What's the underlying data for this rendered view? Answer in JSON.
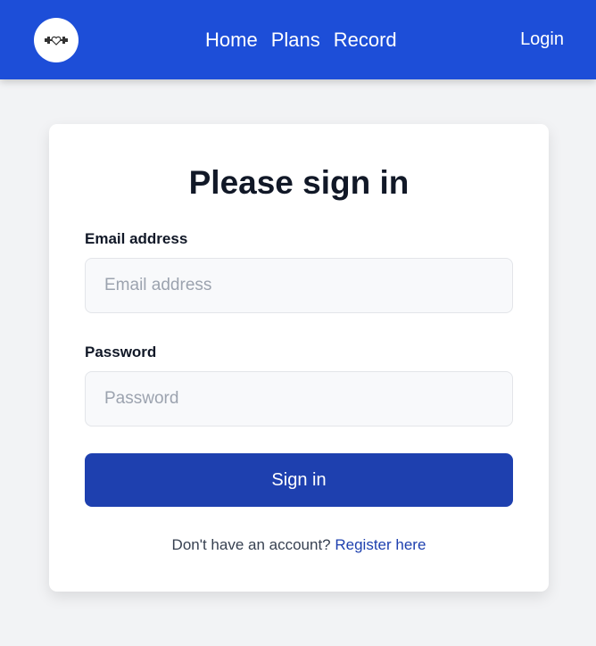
{
  "nav": {
    "logo_icon": "dumbbell-heart-icon",
    "links": [
      "Home",
      "Plans",
      "Record"
    ],
    "login_label": "Login"
  },
  "form": {
    "title": "Please sign in",
    "email": {
      "label": "Email address",
      "placeholder": "Email address",
      "value": ""
    },
    "password": {
      "label": "Password",
      "placeholder": "Password",
      "value": ""
    },
    "submit_label": "Sign in",
    "footer_prefix": "Don't have an account?",
    "register_label": "Register here"
  },
  "colors": {
    "navbar": "#1d4ed8",
    "primary_button": "#1e40af",
    "link": "#1e40af",
    "page_background": "#f2f3f5"
  }
}
